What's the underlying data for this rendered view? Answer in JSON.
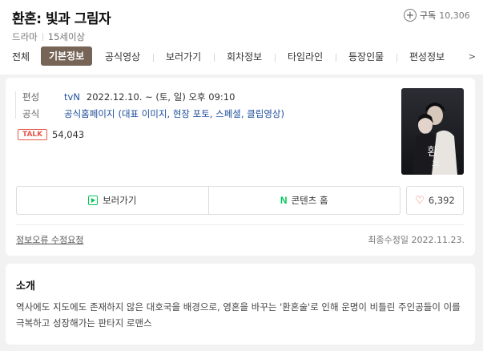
{
  "header": {
    "title": "환혼: 빛과 그림자",
    "genre": "드라마",
    "rating": "15세이상",
    "subscribe_label": "구독",
    "subscribe_count": "10,306"
  },
  "tabs": [
    {
      "label": "전체"
    },
    {
      "label": "기본정보",
      "active": true
    },
    {
      "label": "공식영상"
    },
    {
      "label": "보러가기"
    },
    {
      "label": "회차정보"
    },
    {
      "label": "타임라인"
    },
    {
      "label": "등장인물"
    },
    {
      "label": "편성정보"
    }
  ],
  "info": {
    "broadcast_label": "편성",
    "channel": "tvN",
    "schedule": "2022.12.10. ~  (토, 일) 오후 09:10",
    "official_label": "공식",
    "official_link": "공식홈페이지",
    "official_extra": "(대표 이미지, 현장 포토, 스페셜, 클립영상)",
    "talk_badge": "TALK",
    "talk_count": "54,043"
  },
  "actions": {
    "watch_label": "보러가기",
    "content_home_label": "콘텐츠 홈",
    "like_count": "6,392"
  },
  "footer": {
    "report_label": "정보오류 수정요청",
    "updated": "최종수정일 2022.11.23."
  },
  "intro": {
    "title": "소개",
    "text": "역사에도 지도에도 존재하지 않은 대호국을 배경으로, 영혼을 바꾸는 '환혼술'로 인해 운명이 비틀린 주인공들이 이를 극복하고 성장해가는 판타지 로맨스"
  },
  "colors": {
    "active_tab": "#766456",
    "link": "#1c4d9b",
    "naver_green": "#03c75a",
    "talk_red": "#e8584d"
  }
}
